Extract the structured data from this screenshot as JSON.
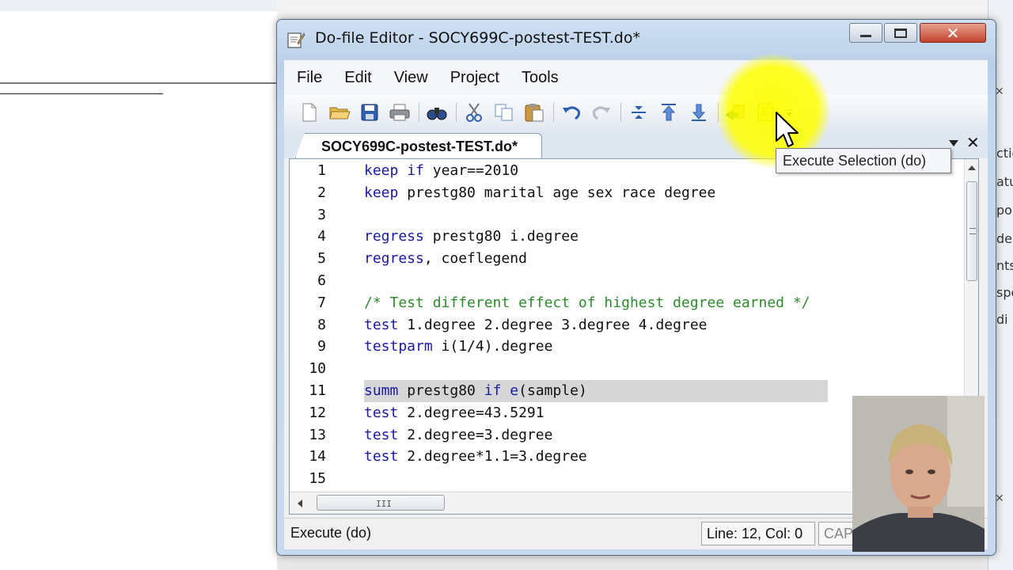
{
  "window": {
    "title": "Do-file Editor - SOCY699C-postest-TEST.do*"
  },
  "menu": [
    "File",
    "Edit",
    "View",
    "Project",
    "Tools"
  ],
  "toolbar": {
    "icons": [
      "new-file-icon",
      "open-folder-icon",
      "save-icon",
      "print-icon",
      "find-icon",
      "cut-icon",
      "copy-icon",
      "paste-icon",
      "undo-icon",
      "redo-icon",
      "shift-right-icon",
      "bookmark-up-icon",
      "bookmark-down-icon",
      "run-icon",
      "execute-do-icon",
      "dropdown-icon"
    ]
  },
  "tab": {
    "label": "SOCY699C-postest-TEST.do*"
  },
  "tooltip": "Execute Selection (do)",
  "code_lines": [
    {
      "n": "1",
      "text": "keep if year==2010"
    },
    {
      "n": "2",
      "text": "keep prestg80 marital age sex race degree"
    },
    {
      "n": "3",
      "text": ""
    },
    {
      "n": "4",
      "text": "regress prestg80 i.degree"
    },
    {
      "n": "5",
      "text": "regress, coeflegend"
    },
    {
      "n": "6",
      "text": ""
    },
    {
      "n": "7",
      "text": "/* Test different effect of highest degree earned */"
    },
    {
      "n": "8",
      "text": "test 1.degree 2.degree 3.degree 4.degree"
    },
    {
      "n": "9",
      "text": "testparm i(1/4).degree"
    },
    {
      "n": "10",
      "text": ""
    },
    {
      "n": "11",
      "text": "summ prestg80 if e(sample)"
    },
    {
      "n": "12",
      "text": "test 2.degree=43.5291"
    },
    {
      "n": "13",
      "text": "test 2.degree=3.degree"
    },
    {
      "n": "14",
      "text": "test 2.degree*1.1=3.degree"
    },
    {
      "n": "15",
      "text": ""
    }
  ],
  "selected_line": "11",
  "scrollbar_grip": "III",
  "status": {
    "text": "Execute (do)",
    "position": "Line: 12, Col: 0",
    "caps": "CAP"
  },
  "background": {
    "right_fragments": [
      "ctic",
      "atu",
      "po",
      "de",
      "nts",
      "spe",
      "di"
    ]
  },
  "colors": {
    "keyword": "#1a1aa6",
    "comment": "#2e8b2e",
    "highlight": "#ffff00"
  }
}
